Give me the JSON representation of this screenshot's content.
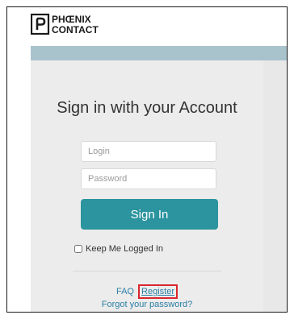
{
  "brand": {
    "logo_line1": "PHŒNIX",
    "logo_line2": "CONTACT",
    "accent": "#2b949e",
    "header_bar": "#a9c3cc"
  },
  "form": {
    "title": "Sign in with your Account",
    "login_placeholder": "Login",
    "login_value": "",
    "password_placeholder": "Password",
    "password_value": "",
    "signin_label": "Sign In",
    "keep_logged_in_label": "Keep Me Logged In",
    "keep_logged_in_checked": false
  },
  "links": {
    "faq": "FAQ",
    "register": "Register",
    "forgot_password": "Forgot your password?"
  },
  "highlight": {
    "target": "register",
    "color": "#d9262c"
  }
}
